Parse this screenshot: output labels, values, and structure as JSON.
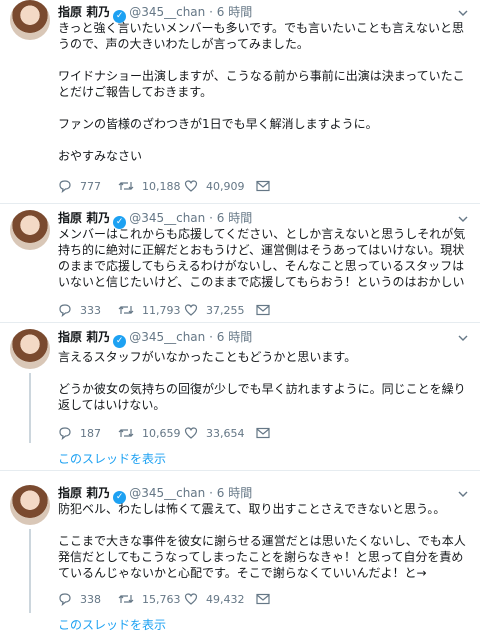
{
  "tweets": [
    {
      "name": "指原 莉乃",
      "handle": "@345__chan",
      "sep": "·",
      "time": "6 時間",
      "lines": [
        "きっと強く言いたいメンバーも多いです。でも言いたいことも言えないと思うので、声の大きいわたしが言ってみました。",
        "ワイドナショー出演しますが、こうなる前から事前に出演は決まっていたことだけご報告しておきます。",
        "ファンの皆様のざわつきが1日でも早く解消しますように。",
        "おやすみなさい"
      ],
      "replies": "777",
      "retweets": "10,188",
      "likes": "40,909"
    },
    {
      "name": "指原 莉乃",
      "handle": "@345__chan",
      "sep": "·",
      "time": "6 時間",
      "lines": [
        "メンバーはこれからも応援してください、としか言えないと思うしそれが気持ち的に絶対に正解だとおもうけど、運営側はそうあってはいけない。現状のままで応援してもらえるわけがないし、そんなこと思っているスタッフはいないと信じたいけど、このままで応援してもらおう！というのはおかしい"
      ],
      "replies": "333",
      "retweets": "11,793",
      "likes": "37,255"
    },
    {
      "name": "指原 莉乃",
      "handle": "@345__chan",
      "sep": "·",
      "time": "6 時間",
      "lines": [
        "言えるスタッフがいなかったこともどうかと思います。",
        "どうか彼女の気持ちの回復が少しでも早く訪れますように。同じことを繰り返してはいけない。"
      ],
      "replies": "187",
      "retweets": "10,659",
      "likes": "33,654",
      "thread_link": "このスレッドを表示"
    },
    {
      "name": "指原 莉乃",
      "handle": "@345__chan",
      "sep": "·",
      "time": "6 時間",
      "lines": [
        "防犯ベル、わたしは怖くて震えて、取り出すことさえできないと思う。。",
        "ここまで大きな事件を彼女に謝らせる運営だとは思いたくないし、でも本人発信だとしてもこうなってしまったことを謝らなきゃ！と思って自分を責めているんじゃないかと心配です。そこで謝らなくていいんだよ！と→"
      ],
      "replies": "338",
      "retweets": "15,763",
      "likes": "49,432",
      "thread_link": "このスレッドを表示"
    }
  ],
  "icons": {
    "reply": "reply-icon",
    "retweet": "retweet-icon",
    "like": "heart-icon",
    "dm": "mail-icon",
    "verified": "verified-badge-icon",
    "more": "chevron-down-icon"
  },
  "colors": {
    "accent": "#1da1f2",
    "secondary_text": "#657786",
    "divider": "#e6ecf0"
  }
}
